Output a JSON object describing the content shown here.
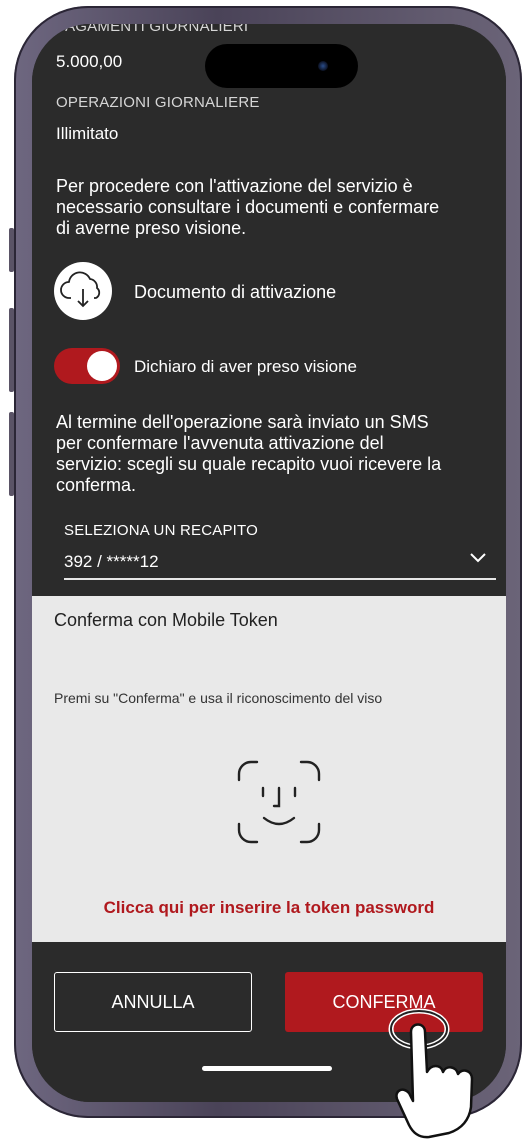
{
  "status": {
    "cut_label": "PAGAMENTI GIORNALIERI"
  },
  "limits": {
    "payments_value": "5.000,00",
    "operations_label": "OPERAZIONI GIORNALIERE",
    "operations_value": "Illimitato"
  },
  "activation": {
    "intro_line1": "Per procedere con l'attivazione del servizio è",
    "intro_line2": "necessario consultare i documenti e confermare",
    "intro_line3": "di averne preso visione.",
    "document_label": "Documento di attivazione",
    "consent_label": "Dichiaro di aver preso visione",
    "consent_checked": true,
    "sms_line1": "Al termine dell'operazione sarà inviato un SMS",
    "sms_line2": "per confermare l'avvenuta attivazione del",
    "sms_line3": "servizio: scegli su quale recapito vuoi ricevere la",
    "sms_line4": "conferma."
  },
  "contact_select": {
    "label": "SELEZIONA UN RECAPITO",
    "value": "392 / *****12"
  },
  "token": {
    "title": "Conferma con Mobile Token",
    "instruction": "Premi su \"Conferma\" e usa il riconoscimento del viso",
    "password_link": "Clicca qui per inserire la token password"
  },
  "actions": {
    "cancel_label": "ANNULLA",
    "confirm_label": "CONFERMA"
  },
  "colors": {
    "accent": "#b0191e",
    "background": "#2b2b2b",
    "panel": "#e9e9e9"
  },
  "icons": [
    "cloud-download-icon",
    "chevron-down-icon",
    "face-id-icon",
    "hand-pointer-icon"
  ]
}
